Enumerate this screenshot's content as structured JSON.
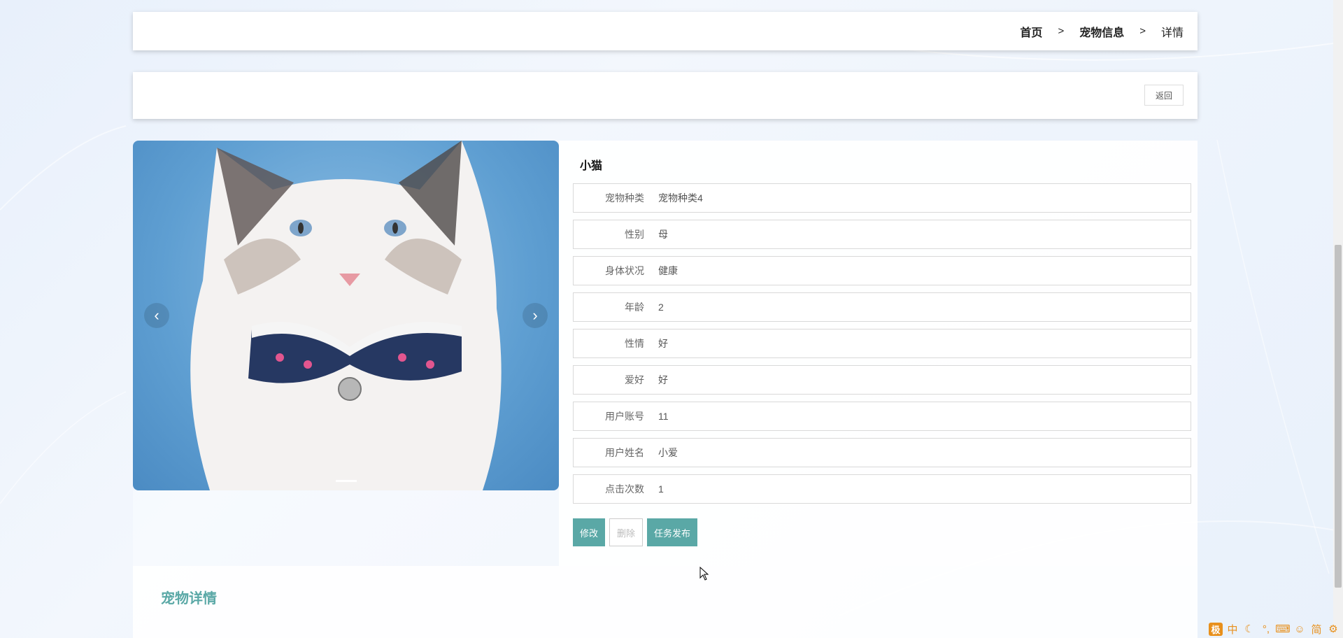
{
  "breadcrumb": {
    "home": "首页",
    "separator": ">",
    "section": "宠物信息",
    "current": "详情"
  },
  "actions": {
    "back_label": "返回"
  },
  "gallery": {
    "prev": "‹",
    "next": "›"
  },
  "pet": {
    "name": "小猫",
    "fields": [
      {
        "label": "宠物种类",
        "value": "宠物种类4"
      },
      {
        "label": "性别",
        "value": "母"
      },
      {
        "label": "身体状况",
        "value": "健康"
      },
      {
        "label": "年龄",
        "value": "2"
      },
      {
        "label": "性情",
        "value": "好"
      },
      {
        "label": "爱好",
        "value": "好"
      },
      {
        "label": "用户账号",
        "value": "11"
      },
      {
        "label": "用户姓名",
        "value": "小爱"
      },
      {
        "label": "点击次数",
        "value": "1"
      }
    ]
  },
  "buttons": {
    "edit": "修改",
    "delete": "删除",
    "publish": "任务发布"
  },
  "detail": {
    "title": "宠物详情"
  },
  "ime": {
    "logo": "极",
    "mode": "中",
    "simplified": "简"
  },
  "colors": {
    "accent": "#5aa8a6",
    "ime": "#e8901c"
  }
}
